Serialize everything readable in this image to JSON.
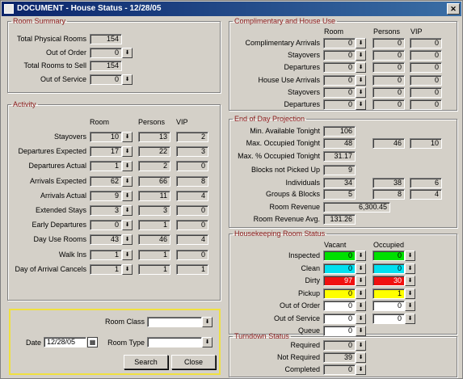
{
  "window": {
    "title": "DOCUMENT - House Status - 12/28/05"
  },
  "room_summary": {
    "legend": "Room Summary",
    "rows": [
      {
        "label": "Total Physical Rooms",
        "value": "154"
      },
      {
        "label": "Out of Order",
        "value": "0"
      },
      {
        "label": "Total Rooms to Sell",
        "value": "154"
      },
      {
        "label": "Out of Service",
        "value": "0"
      }
    ]
  },
  "activity": {
    "legend": "Activity",
    "headers": [
      "Room",
      "Persons",
      "VIP"
    ],
    "rows": [
      {
        "label": "Stayovers",
        "room": "10",
        "persons": "13",
        "vip": "2"
      },
      {
        "label": "Departures Expected",
        "room": "17",
        "persons": "22",
        "vip": "3"
      },
      {
        "label": "Departures Actual",
        "room": "1",
        "persons": "2",
        "vip": "0"
      },
      {
        "label": "Arrivals Expected",
        "room": "62",
        "persons": "66",
        "vip": "8"
      },
      {
        "label": "Arrivals Actual",
        "room": "9",
        "persons": "11",
        "vip": "4"
      },
      {
        "label": "Extended Stays",
        "room": "3",
        "persons": "3",
        "vip": "0"
      },
      {
        "label": "Early Departures",
        "room": "0",
        "persons": "1",
        "vip": "0"
      },
      {
        "label": "Day Use Rooms",
        "room": "43",
        "persons": "46",
        "vip": "4"
      },
      {
        "label": "Walk Ins",
        "room": "1",
        "persons": "1",
        "vip": "0"
      },
      {
        "label": "Day of Arrival Cancels",
        "room": "1",
        "persons": "1",
        "vip": "1"
      }
    ]
  },
  "search": {
    "room_class_label": "Room Class",
    "date_label": "Date",
    "date_value": "12/28/05",
    "room_type_label": "Room Type",
    "search_label": "Search",
    "close_label": "Close"
  },
  "comp_house": {
    "legend": "Complimentary and House Use",
    "headers": [
      "Room",
      "Persons",
      "VIP"
    ],
    "rows": [
      {
        "label": "Complimentary Arrivals",
        "room": "0",
        "persons": "0",
        "vip": "0"
      },
      {
        "label": "Stayovers",
        "room": "0",
        "persons": "0",
        "vip": "0"
      },
      {
        "label": "Departures",
        "room": "0",
        "persons": "0",
        "vip": "0"
      },
      {
        "label": "House Use Arrivals",
        "room": "0",
        "persons": "0",
        "vip": "0"
      },
      {
        "label": "Stayovers",
        "room": "0",
        "persons": "0",
        "vip": "0"
      },
      {
        "label": "Departures",
        "room": "0",
        "persons": "0",
        "vip": "0"
      }
    ]
  },
  "eod": {
    "legend": "End of Day Projection",
    "min_available": {
      "label": "Min. Available Tonight",
      "value": "106"
    },
    "max_occupied": {
      "label": "Max. Occupied Tonight",
      "room": "48",
      "persons": "46",
      "vip": "10"
    },
    "max_pct": {
      "label": "Max. % Occupied Tonight",
      "value": "31.17"
    },
    "blocks_not_picked": {
      "label": "Blocks not Picked Up",
      "value": "9"
    },
    "individuals": {
      "label": "Individuals",
      "room": "34",
      "persons": "38",
      "vip": "6"
    },
    "groups": {
      "label": "Groups & Blocks",
      "room": "5",
      "persons": "8",
      "vip": "4"
    },
    "room_revenue": {
      "label": "Room Revenue",
      "value": "6,300.45"
    },
    "room_revenue_avg": {
      "label": "Room Revenue Avg.",
      "value": "131.26"
    }
  },
  "housekeeping": {
    "legend": "Housekeeping Room Status",
    "headers": [
      "Vacant",
      "Occupied"
    ],
    "rows": [
      {
        "label": "Inspected",
        "vacant": "0",
        "occupied": "0",
        "color": "#00e000"
      },
      {
        "label": "Clean",
        "vacant": "0",
        "occupied": "0",
        "color": "#00e0f0"
      },
      {
        "label": "Dirty",
        "vacant": "97",
        "occupied": "30",
        "color": "#f01010"
      },
      {
        "label": "Pickup",
        "vacant": "0",
        "occupied": "1",
        "color": "#ffff00"
      },
      {
        "label": "Out of Order",
        "vacant": "0",
        "occupied": "0",
        "color": "#ffffff"
      },
      {
        "label": "Out of Service",
        "vacant": "0",
        "occupied": "0",
        "color": "#ffffff"
      },
      {
        "label": "Queue",
        "vacant": "0",
        "occupied": "",
        "color": "#ffffff"
      }
    ]
  },
  "turndown": {
    "legend": "Turndown Status",
    "rows": [
      {
        "label": "Required",
        "value": "0"
      },
      {
        "label": "Not Required",
        "value": "39"
      },
      {
        "label": "Completed",
        "value": "0"
      }
    ]
  }
}
